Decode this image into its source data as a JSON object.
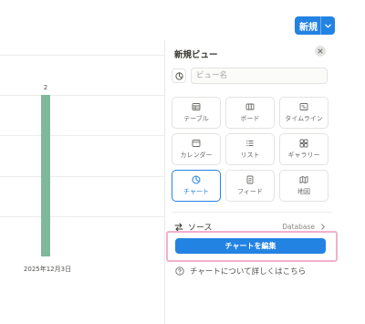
{
  "toolbar": {
    "filter_icon": "filter-icon",
    "settings_icon": "settings-sliders-icon",
    "new_label": "新規",
    "new_menu_icon": "chevron-down-icon"
  },
  "chart_data": {
    "type": "bar",
    "categories": [
      "2025年12月3日"
    ],
    "values": [
      2
    ],
    "title": "",
    "xlabel": "",
    "ylabel": "",
    "data_labels": [
      "2"
    ],
    "ylim": [
      0,
      2.5
    ],
    "grid": true,
    "colors": {
      "bar": "#7fb89a"
    }
  },
  "panel": {
    "title": "新規ビュー",
    "name_placeholder": "ビュー名",
    "view_types": [
      {
        "label": "テーブル",
        "icon": "table-icon"
      },
      {
        "label": "ボード",
        "icon": "board-icon"
      },
      {
        "label": "タイムライン",
        "icon": "timeline-icon"
      },
      {
        "label": "カレンダー",
        "icon": "calendar-icon"
      },
      {
        "label": "リスト",
        "icon": "list-icon"
      },
      {
        "label": "ギャラリー",
        "icon": "gallery-icon"
      },
      {
        "label": "チャート",
        "icon": "chart-icon",
        "selected": true
      },
      {
        "label": "フィード",
        "icon": "feed-icon"
      },
      {
        "label": "地図",
        "icon": "map-icon"
      }
    ],
    "source_label": "ソース",
    "source_value": "Database",
    "edit_chart_label": "チャートを編集",
    "help_label": "チャートについて詳しくはこちら"
  },
  "colors": {
    "accent": "#2383e2",
    "highlight": "#f1b0cc"
  }
}
